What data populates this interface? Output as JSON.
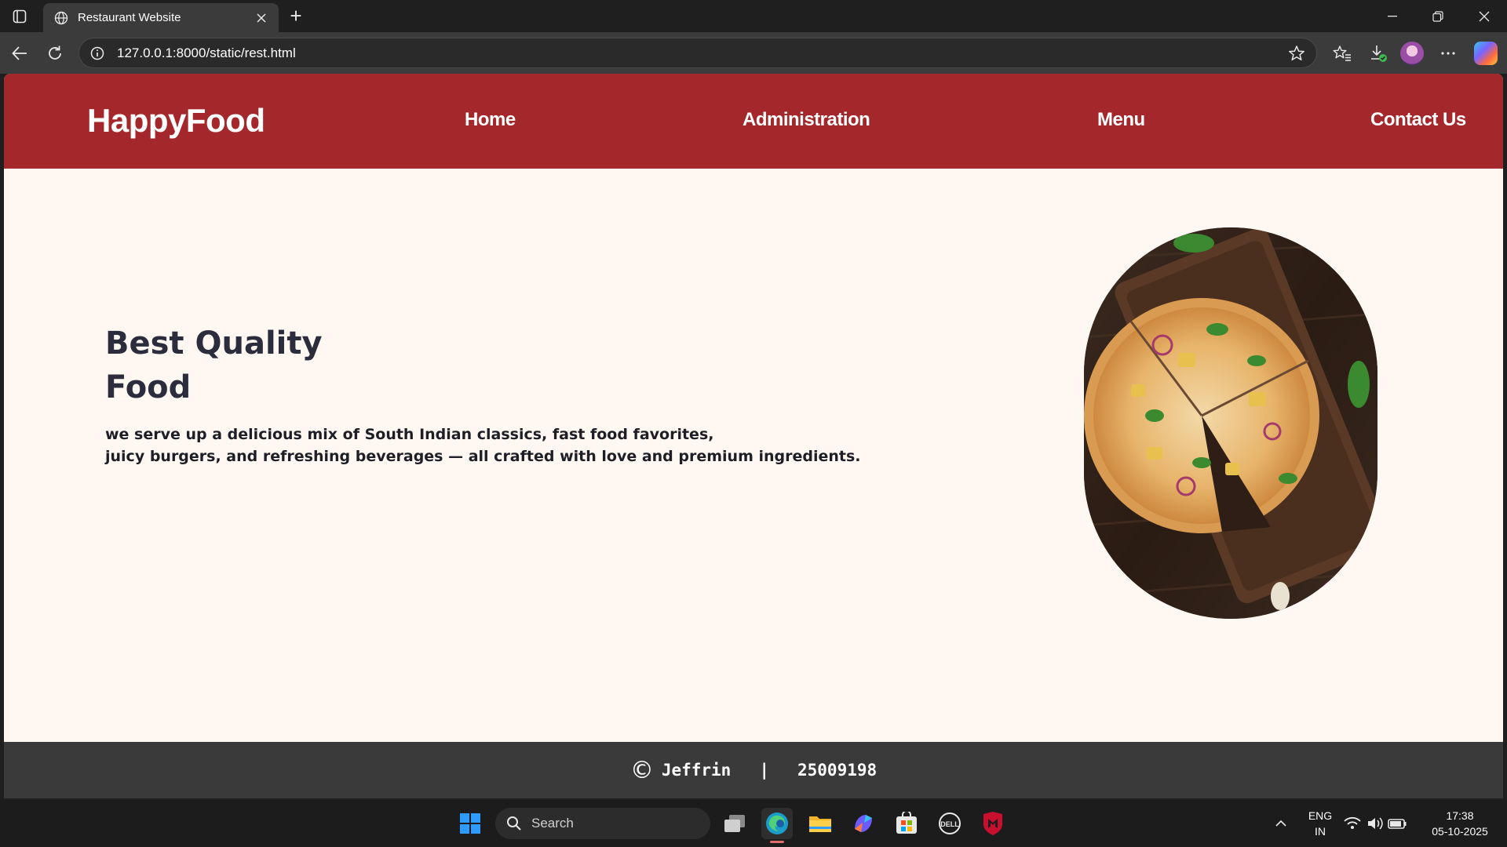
{
  "browser": {
    "tab_title": "Restaurant Website",
    "new_tab_symbol": "+",
    "url": "127.0.0.1:8000/static/rest.html"
  },
  "site": {
    "brand": "HappyFood",
    "nav": {
      "home": "Home",
      "administration": "Administration",
      "menu": "Menu",
      "contact": "Contact Us"
    },
    "hero": {
      "title_line1": "Best Quality",
      "title_line2": "Food",
      "desc_line1": "we serve up a delicious mix of South Indian classics, fast food favorites,",
      "desc_line2": "juicy burgers, and refreshing beverages — all crafted with love and premium ingredients."
    },
    "footer": {
      "copyright_symbol": "©",
      "name": "Jeffrin",
      "separator": "|",
      "id": "25009198"
    },
    "colors": {
      "navbar": "#a4282b",
      "page_bg": "#fff8f2",
      "footer_bg": "#3a3a3a",
      "heading": "#2b2d3d"
    }
  },
  "taskbar": {
    "search_placeholder": "Search",
    "lang_line1": "ENG",
    "lang_line2": "IN",
    "time": "17:38",
    "date": "05-10-2025",
    "icons": [
      "windows-start-icon",
      "task-view-icon",
      "edge-icon",
      "file-explorer-icon",
      "copilot-icon",
      "microsoft-store-icon",
      "dell-icon",
      "mcafee-icon"
    ]
  }
}
